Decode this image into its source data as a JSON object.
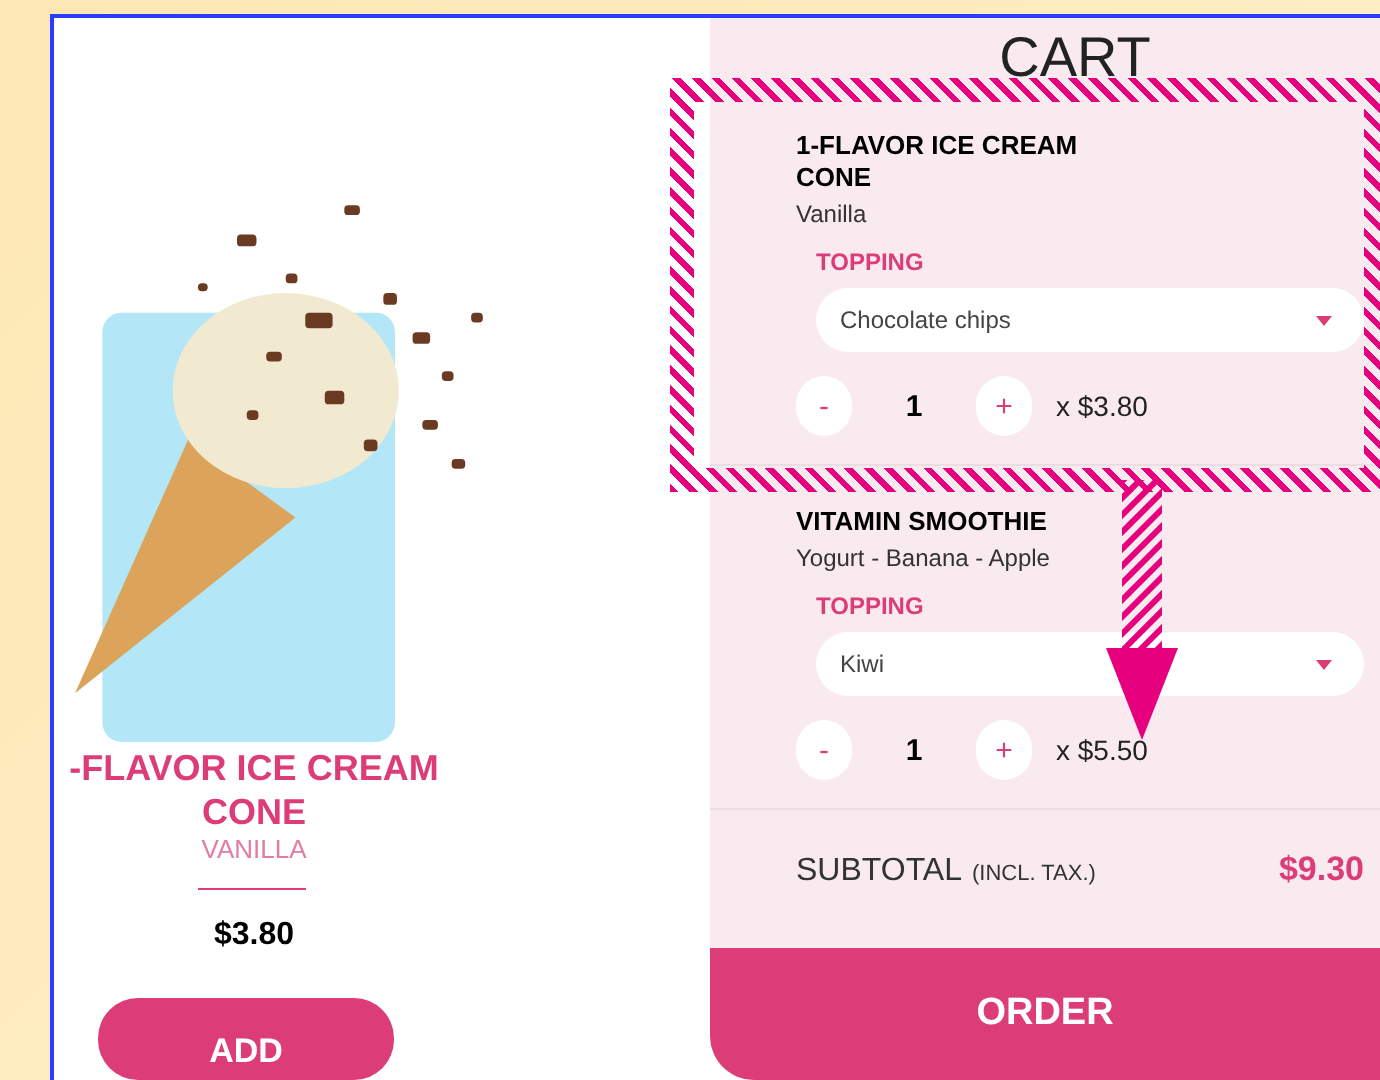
{
  "product": {
    "title": "-FLAVOR ICE CREAM CONE",
    "flavor": "VANILLA",
    "price": "$3.80",
    "add_button": "ADD"
  },
  "cart": {
    "title": "CART",
    "items": [
      {
        "name": "1-FLAVOR ICE CREAM CONE",
        "detail": "Vanilla",
        "topping_label": "TOPPING",
        "topping": "Chocolate chips",
        "minus": "-",
        "quantity": "1",
        "plus": "+",
        "unit_price": "x $3.80",
        "highlighted": true
      },
      {
        "name": "VITAMIN SMOOTHIE",
        "detail": "Yogurt - Banana - Apple",
        "topping_label": "TOPPING",
        "topping": "Kiwi",
        "minus": "-",
        "quantity": "1",
        "plus": "+",
        "unit_price": "x $5.50",
        "highlighted": false
      }
    ],
    "subtotal_label": "SUBTOTAL",
    "subtotal_note": "(INCL. TAX.)",
    "subtotal": "$9.30",
    "order_button": "ORDER"
  }
}
